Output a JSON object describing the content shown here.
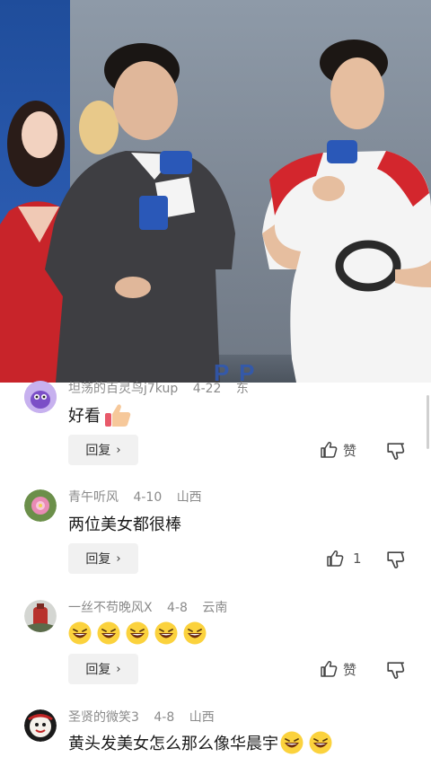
{
  "video": {
    "banner_text": "P P"
  },
  "comments": [
    {
      "username": "坦荡的百灵鸟j7kup",
      "date": "4-22",
      "location": "东",
      "text": "好看",
      "reply_label": "回复",
      "like_label": "赞",
      "emojis": [
        "thumbs-up-emoji"
      ]
    },
    {
      "username": "青午听风",
      "date": "4-10",
      "location": "山西",
      "text": "两位美女都很棒",
      "reply_label": "回复",
      "like_label": "1",
      "emojis": []
    },
    {
      "username": "一丝不苟晚风X",
      "date": "4-8",
      "location": "云南",
      "text": "",
      "reply_label": "回复",
      "like_label": "赞",
      "emojis": [
        "laugh-emoji",
        "laugh-emoji",
        "laugh-emoji",
        "laugh-emoji",
        "laugh-emoji"
      ]
    },
    {
      "username": "圣贤的微笑3",
      "date": "4-8",
      "location": "山西",
      "text": "黄头发美女怎么那么像华晨宇",
      "reply_label": "",
      "like_label": "",
      "emojis": [
        "laugh-emoji",
        "laugh-emoji"
      ]
    }
  ],
  "colors": {
    "accent": "#2f59b5",
    "meta_text": "#8a8a8a",
    "reply_bg": "#f1f1f1"
  }
}
